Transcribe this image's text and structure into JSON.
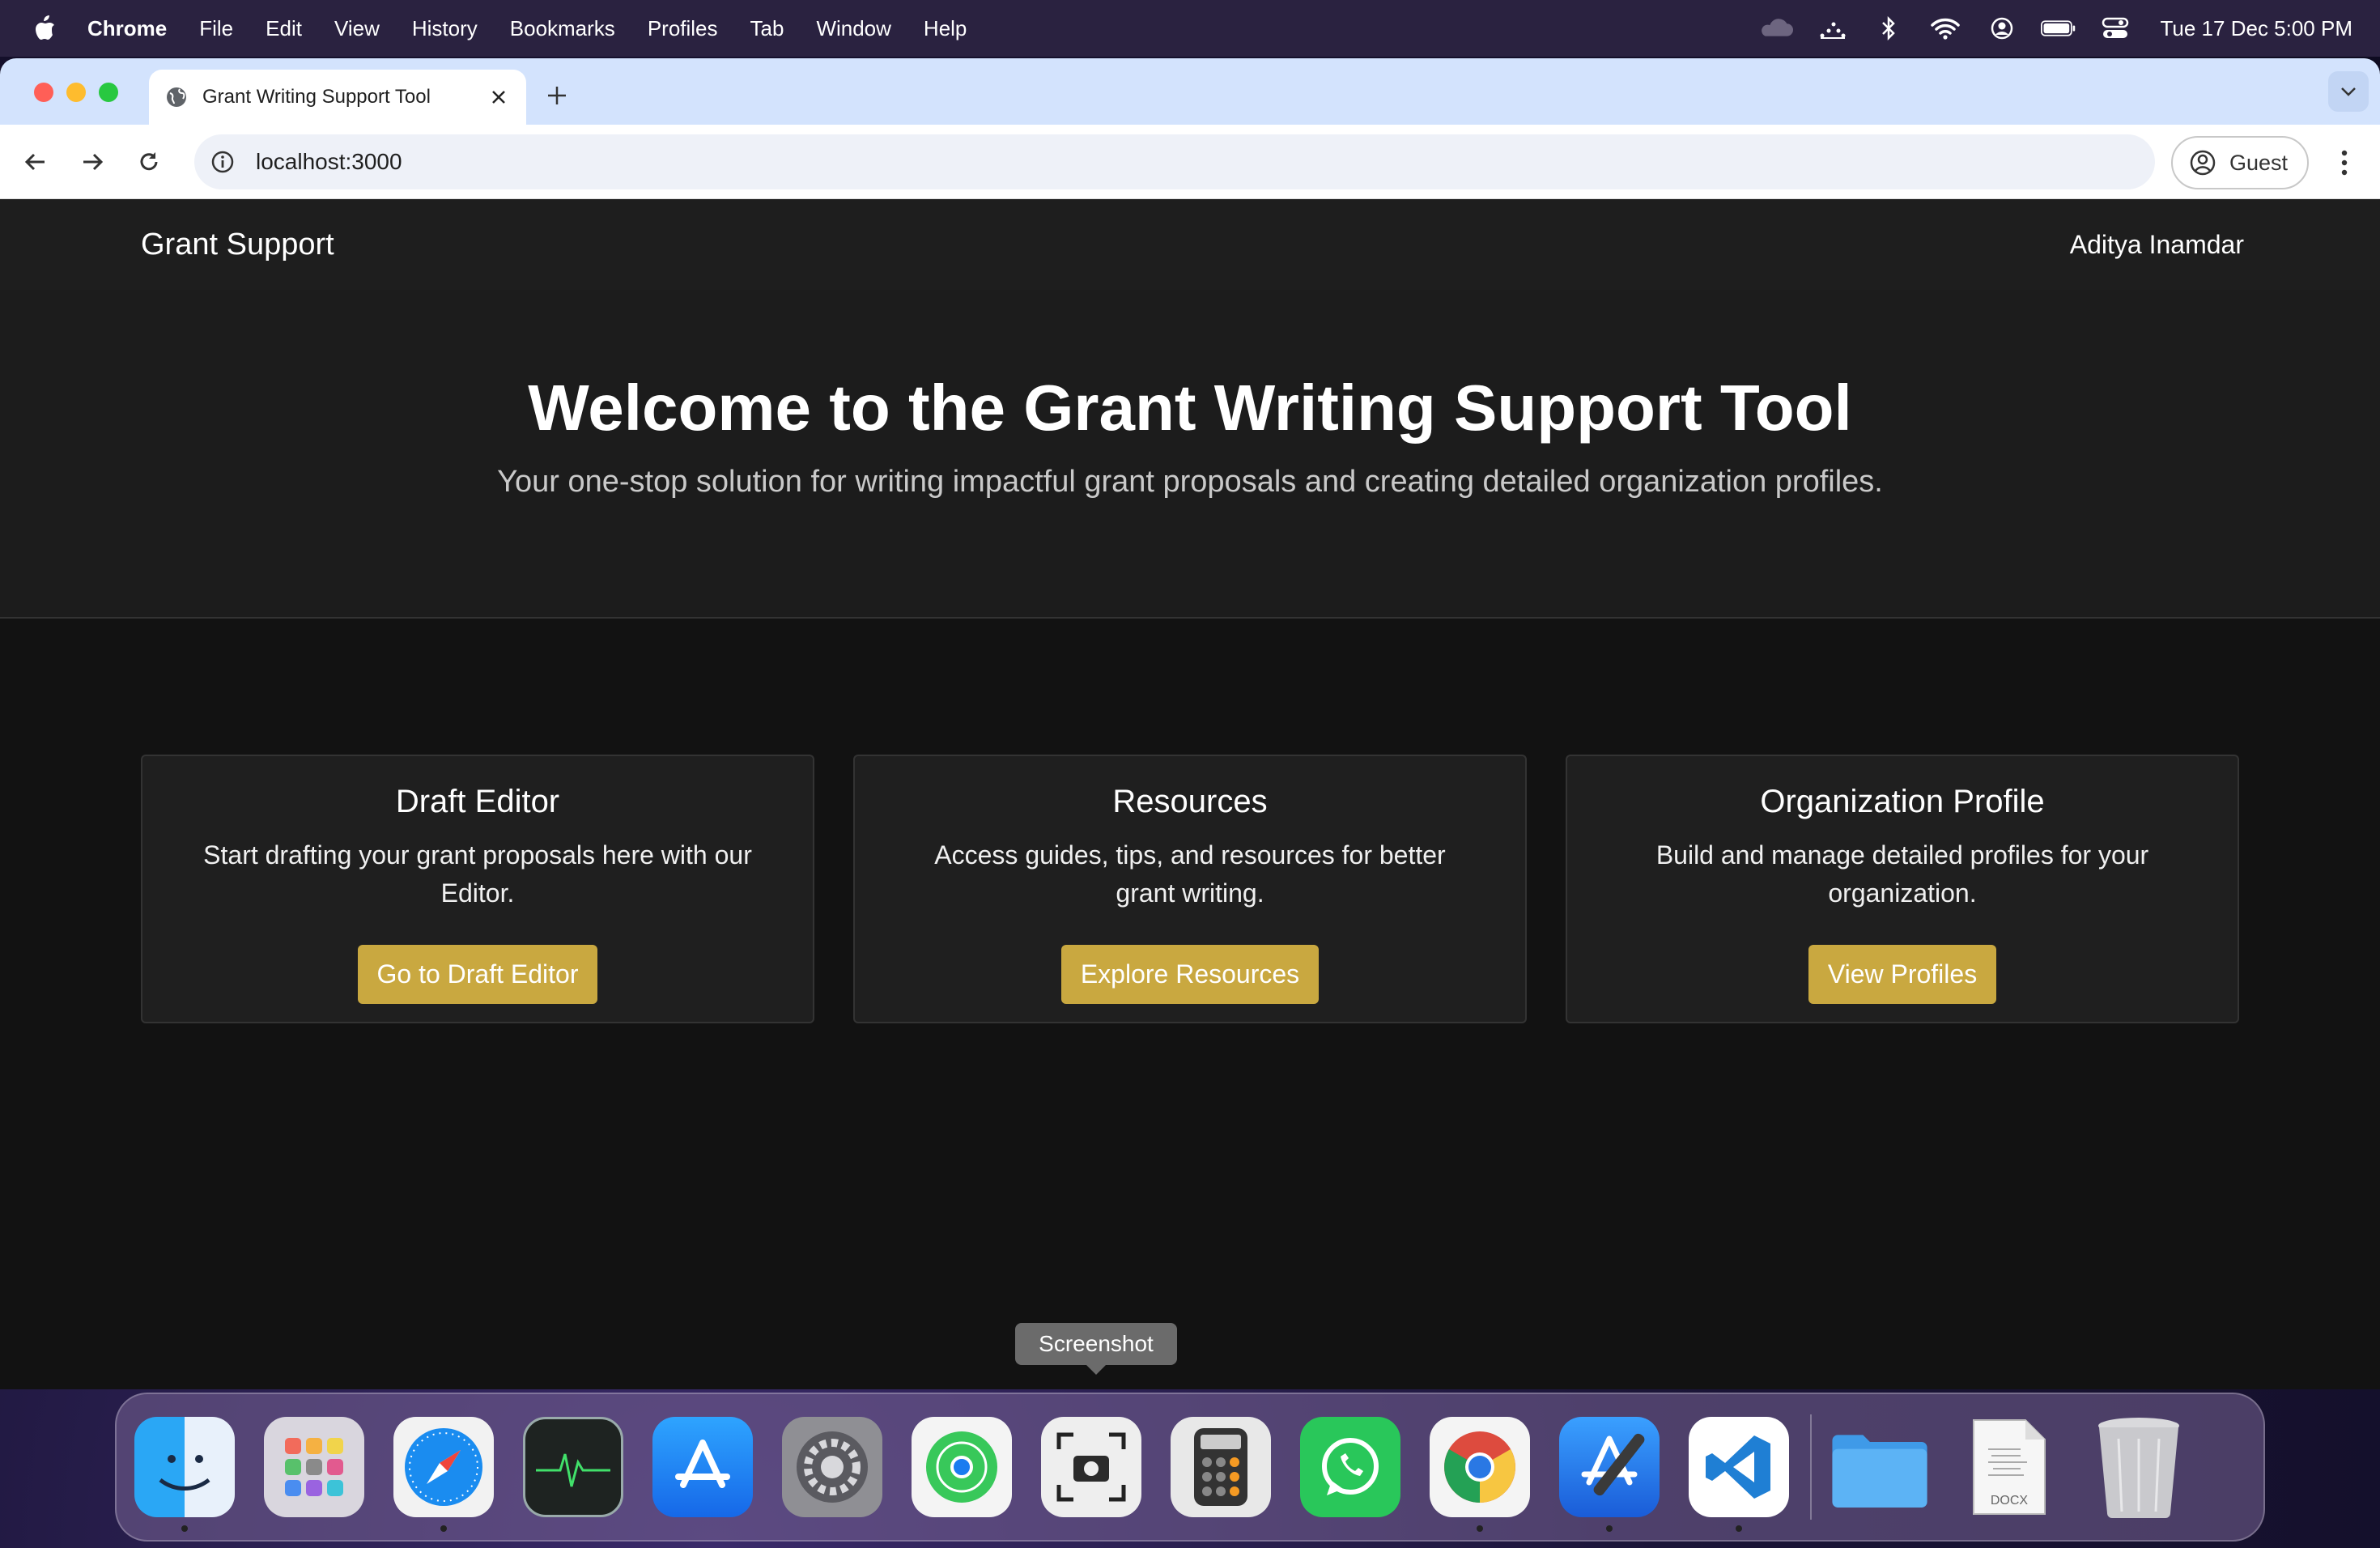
{
  "menubar": {
    "app_name": "Chrome",
    "items": [
      "File",
      "Edit",
      "View",
      "History",
      "Bookmarks",
      "Profiles",
      "Tab",
      "Window",
      "Help"
    ],
    "clock": "Tue 17 Dec  5:00 PM"
  },
  "browser": {
    "tab_title": "Grant Writing Support Tool",
    "url": "localhost:3000",
    "profile_label": "Guest"
  },
  "page": {
    "brand": "Grant Support",
    "user_name": "Aditya Inamdar",
    "hero_title": "Welcome to the Grant Writing Support Tool",
    "hero_subtitle": "Your one-stop solution for writing impactful grant proposals and creating detailed organization profiles.",
    "cards": [
      {
        "title": "Draft Editor",
        "text": "Start drafting your grant proposals here with our Editor.",
        "button": "Go to Draft Editor"
      },
      {
        "title": "Resources",
        "text": "Access guides, tips, and resources for better grant writing.",
        "button": "Explore Resources"
      },
      {
        "title": "Organization Profile",
        "text": "Build and manage detailed profiles for your organization.",
        "button": "View Profiles"
      }
    ]
  },
  "tooltip": "Screenshot",
  "colors": {
    "accent_button": "#c9a840",
    "page_bg": "#121212",
    "navbar_bg": "#1e1e1e",
    "card_bg": "#1f1f1f"
  },
  "dock_icons": [
    "finder-icon",
    "launchpad-icon",
    "safari-icon",
    "activity-monitor-icon",
    "app-store-icon",
    "system-settings-icon",
    "find-my-icon",
    "screenshot-icon",
    "calculator-icon",
    "whatsapp-icon",
    "chrome-icon",
    "xcode-icon",
    "vscode-icon",
    "folder-icon",
    "docx-file-icon",
    "trash-icon"
  ]
}
